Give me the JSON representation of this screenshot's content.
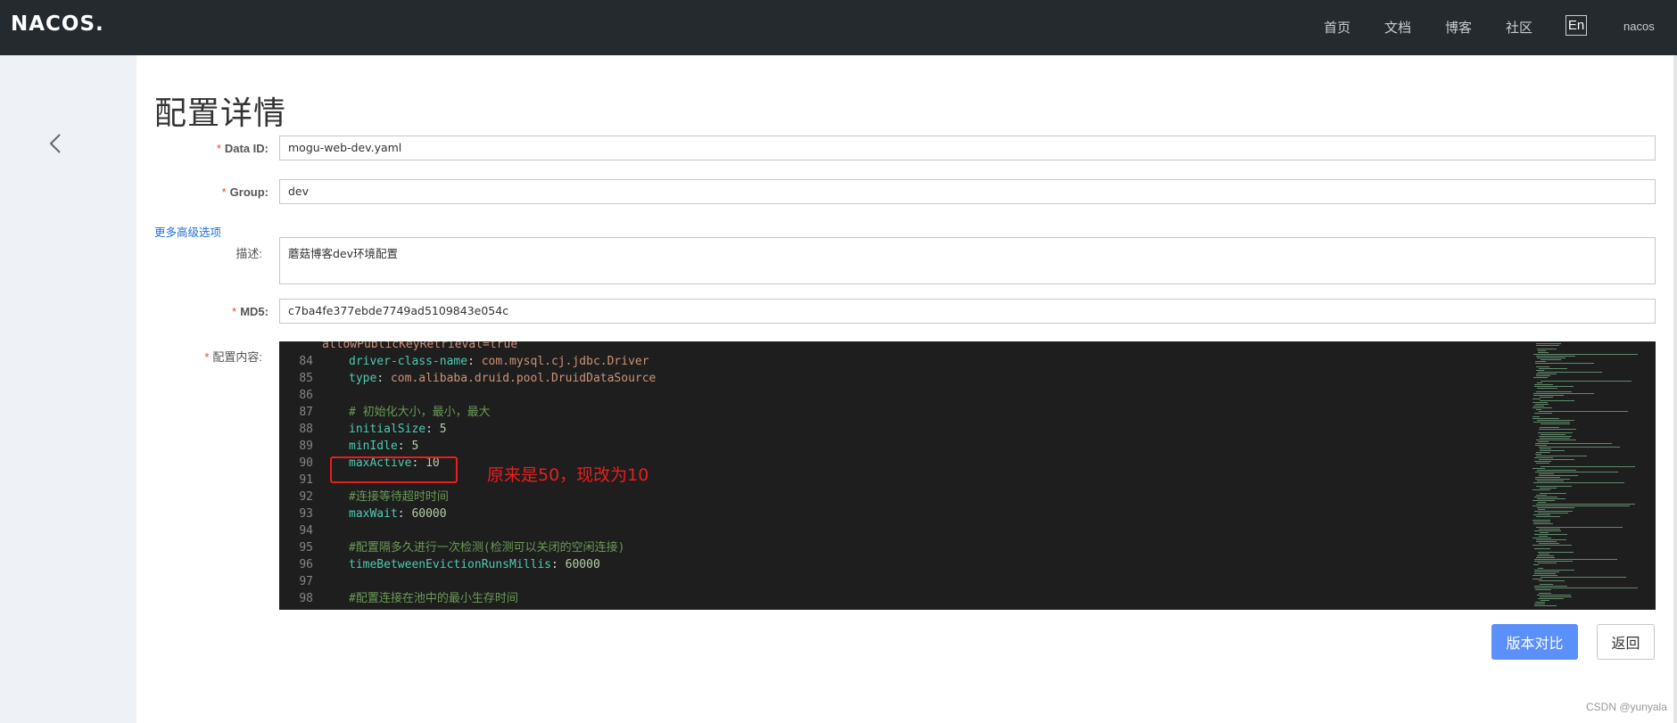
{
  "topbar": {
    "logo": "NACOS.",
    "nav": [
      "首页",
      "文档",
      "博客",
      "社区"
    ],
    "lang": "En",
    "user": "nacos"
  },
  "page": {
    "title": "配置详情"
  },
  "form": {
    "data_id_label": "Data ID:",
    "data_id_value": "mogu-web-dev.yaml",
    "group_label": "Group:",
    "group_value": "dev",
    "more_options": "更多高级选项",
    "desc_label": "描述:",
    "desc_value": "蘑菇博客dev环境配置",
    "md5_label": "MD5:",
    "md5_value": "c7ba4fe377ebde7749ad5109843e054c",
    "content_label": "配置内容:"
  },
  "editor": {
    "partial_top": "allowPublicKeyRetrieval=true",
    "lines": [
      {
        "num": "84",
        "key": "driver-class-name",
        "val": "com.mysql.cj.jdbc.Driver",
        "kind": "kv-str"
      },
      {
        "num": "85",
        "key": "type",
        "val": "com.alibaba.druid.pool.DruidDataSource",
        "kind": "kv-str"
      },
      {
        "num": "86",
        "key": "",
        "val": "",
        "kind": "blank"
      },
      {
        "num": "87",
        "key": "",
        "val": "# 初始化大小，最小，最大",
        "kind": "comment"
      },
      {
        "num": "88",
        "key": "initialSize",
        "val": "5",
        "kind": "kv-num"
      },
      {
        "num": "89",
        "key": "minIdle",
        "val": "5",
        "kind": "kv-num"
      },
      {
        "num": "90",
        "key": "maxActive",
        "val": "10",
        "kind": "kv-num"
      },
      {
        "num": "91",
        "key": "",
        "val": "",
        "kind": "blank"
      },
      {
        "num": "92",
        "key": "",
        "val": "#连接等待超时时间",
        "kind": "comment"
      },
      {
        "num": "93",
        "key": "maxWait",
        "val": "60000",
        "kind": "kv-num"
      },
      {
        "num": "94",
        "key": "",
        "val": "",
        "kind": "blank"
      },
      {
        "num": "95",
        "key": "",
        "val": "#配置隔多久进行一次检测(检测可以关闭的空闲连接)",
        "kind": "comment"
      },
      {
        "num": "96",
        "key": "timeBetweenEvictionRunsMillis",
        "val": "60000",
        "kind": "kv-num"
      },
      {
        "num": "97",
        "key": "",
        "val": "",
        "kind": "blank"
      },
      {
        "num": "98",
        "key": "",
        "val": "#配置连接在池中的最小生存时间",
        "kind": "comment"
      }
    ]
  },
  "annotation": "原来是50，现改为10",
  "buttons": {
    "compare": "版本对比",
    "back": "返回"
  },
  "watermark": "CSDN @yunyala",
  "colors": {
    "topbar": "#252a2f",
    "sidebar": "#eef1f5",
    "primary": "#5b8ff9",
    "required": "#f44336",
    "annotation": "#e81e1e",
    "editor_bg": "#1e1e1e"
  }
}
